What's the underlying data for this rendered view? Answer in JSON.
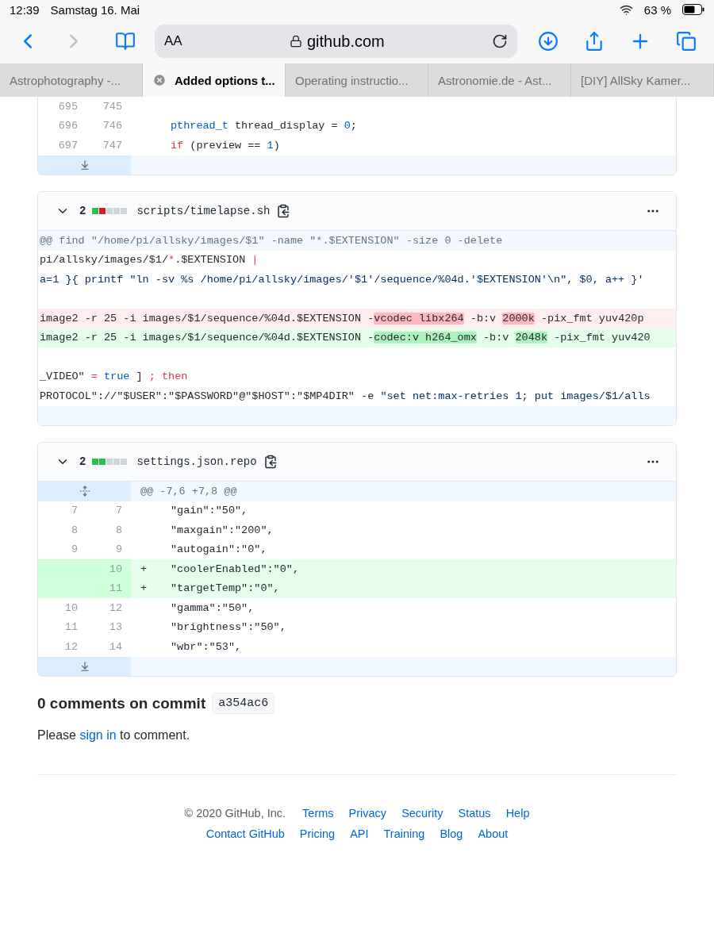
{
  "status_bar": {
    "time": "12:39",
    "date": "Samstag 16. Mai",
    "battery": "63 %"
  },
  "toolbar": {
    "text_size": "AA",
    "address": "github.com",
    "forward_disabled": true
  },
  "tabs": [
    {
      "label": "Astrophotography -...",
      "selected": false
    },
    {
      "label": "Added options t...",
      "selected": true
    },
    {
      "label": "Operating instructio...",
      "selected": false
    },
    {
      "label": "Astronomie.de - Ast...",
      "selected": false
    },
    {
      "label": "[DIY] AllSky Kamer...",
      "selected": false
    }
  ],
  "files": [
    {
      "rows": [
        {
          "kind": "context",
          "old": "695",
          "new": "745"
        },
        {
          "kind": "context",
          "old": "696",
          "new": "746",
          "segments": [
            {
              "text": "pthread_t",
              "kind": "constant"
            },
            {
              "text": " thread_display = ",
              "kind": "plain"
            },
            {
              "text": "0",
              "kind": "constant"
            },
            {
              "text": ";",
              "kind": "plain"
            }
          ]
        },
        {
          "kind": "context",
          "old": "697",
          "new": "747",
          "segments": [
            {
              "text": "if",
              "kind": "keyword"
            },
            {
              "text": " (preview == ",
              "kind": "plain"
            },
            {
              "text": "1",
              "kind": "constant"
            },
            {
              "text": ")",
              "kind": "plain"
            }
          ]
        },
        {
          "kind": "expander"
        }
      ]
    },
    {
      "header": {
        "count": "2",
        "diffstat": [
          {
            "kind": "added"
          },
          {
            "kind": "deleted"
          },
          {
            "kind": "neutral"
          },
          {
            "kind": "neutral"
          },
          {
            "kind": "neutral"
          }
        ],
        "path": "scripts/timelapse.sh"
      },
      "rows": [
        {
          "kind": "hunk",
          "text": "@@ find \"/home/pi/allsky/images/$1\" -name \"*.$EXTENSION\" -size 0 -delete"
        },
        {
          "kind": "context",
          "segments": [
            {
              "text": "pi/allsky/images/$1/",
              "kind": "plain"
            },
            {
              "text": "*",
              "kind": "keyword"
            },
            {
              "text": ".$EXTENSION ",
              "kind": "plain"
            },
            {
              "text": "|",
              "kind": "keyword"
            }
          ]
        },
        {
          "kind": "context",
          "segments": [
            {
              "text": "a=1 }{ printf \"ln -sv %s /home/pi/allsky/images/'$1'/sequence/%04d.'$EXTENSION'\\n\", $0, a++ }'",
              "kind": "string"
            }
          ]
        },
        {
          "kind": "context"
        },
        {
          "kind": "deletion",
          "segments": [
            {
              "text": "image2 -r 25 -i images/$1/sequence/%04d.$EXTENSION -",
              "kind": "plain"
            },
            {
              "text": "vcodec libx264",
              "kind": "changed"
            },
            {
              "text": " -b:v ",
              "kind": "plain"
            },
            {
              "text": "2000k",
              "kind": "changed"
            },
            {
              "text": " -pix_fmt yuv420p",
              "kind": "plain"
            }
          ]
        },
        {
          "kind": "addition",
          "segments": [
            {
              "text": "image2 -r 25 -i images/$1/sequence/%04d.$EXTENSION -",
              "kind": "plain"
            },
            {
              "text": "codec:v h264_omx",
              "kind": "changed"
            },
            {
              "text": " -b:v ",
              "kind": "plain"
            },
            {
              "text": "2048k",
              "kind": "changed"
            },
            {
              "text": " -pix_fmt yuv420",
              "kind": "plain"
            }
          ]
        },
        {
          "kind": "context"
        },
        {
          "kind": "context",
          "segments": [
            {
              "text": "_VIDEO\" ",
              "kind": "plain"
            },
            {
              "text": "=",
              "kind": "keyword"
            },
            {
              "text": " true",
              "kind": "constant"
            },
            {
              "text": " ] ",
              "kind": "plain"
            },
            {
              "text": "; then",
              "kind": "keyword"
            }
          ]
        },
        {
          "kind": "context",
          "segments": [
            {
              "text": "PROTOCOL\"://\"$USER\":\"$PASSWORD\"@\"$HOST\":\"$MP4DIR\" -e ",
              "kind": "plain"
            },
            {
              "text": "\"set net:max-retries 1; put images/$1/alls",
              "kind": "string"
            }
          ]
        },
        {
          "kind": "hunk"
        }
      ]
    },
    {
      "header": {
        "count": "2",
        "diffstat": [
          {
            "kind": "added"
          },
          {
            "kind": "added"
          },
          {
            "kind": "neutral"
          },
          {
            "kind": "neutral"
          },
          {
            "kind": "neutral"
          }
        ],
        "path": "settings.json.repo"
      },
      "rows": [
        {
          "kind": "hunk_expandable",
          "text": "@@ -7,6 +7,8 @@"
        },
        {
          "kind": "context",
          "old": "7",
          "new": "7",
          "segments": [
            {
              "text": "\"gain\":\"50\",",
              "kind": "plain"
            }
          ]
        },
        {
          "kind": "context",
          "old": "8",
          "new": "8",
          "segments": [
            {
              "text": "\"maxgain\":\"200\",",
              "kind": "plain"
            }
          ]
        },
        {
          "kind": "context",
          "old": "9",
          "new": "9",
          "segments": [
            {
              "text": "\"autogain\":\"0\",",
              "kind": "plain"
            }
          ]
        },
        {
          "kind": "addition",
          "new": "10",
          "marker": "+",
          "segments": [
            {
              "text": "\"coolerEnabled\":\"0\",",
              "kind": "plain"
            }
          ]
        },
        {
          "kind": "addition",
          "new": "11",
          "marker": "+",
          "segments": [
            {
              "text": "\"targetTemp\":\"0\",",
              "kind": "plain"
            }
          ]
        },
        {
          "kind": "context",
          "old": "10",
          "new": "12",
          "segments": [
            {
              "text": "\"gamma\":\"50\",",
              "kind": "plain"
            }
          ]
        },
        {
          "kind": "context",
          "old": "11",
          "new": "13",
          "segments": [
            {
              "text": "\"brightness\":\"50\",",
              "kind": "plain"
            }
          ]
        },
        {
          "kind": "context",
          "old": "12",
          "new": "14",
          "segments": [
            {
              "text": "\"wbr\":\"53\",",
              "kind": "plain"
            }
          ]
        },
        {
          "kind": "expander"
        }
      ]
    }
  ],
  "comments": {
    "heading": "0 comments on commit",
    "sha": "a354ac6",
    "before": "Please",
    "link": "sign in",
    "after": "to comment."
  },
  "footer": {
    "copyright": "© 2020 GitHub, Inc.",
    "links": [
      [
        "Terms",
        "Privacy",
        "Security",
        "Status",
        "Help"
      ],
      [
        "Contact GitHub",
        "Pricing",
        "API",
        "Training",
        "Blog",
        "About"
      ]
    ]
  }
}
